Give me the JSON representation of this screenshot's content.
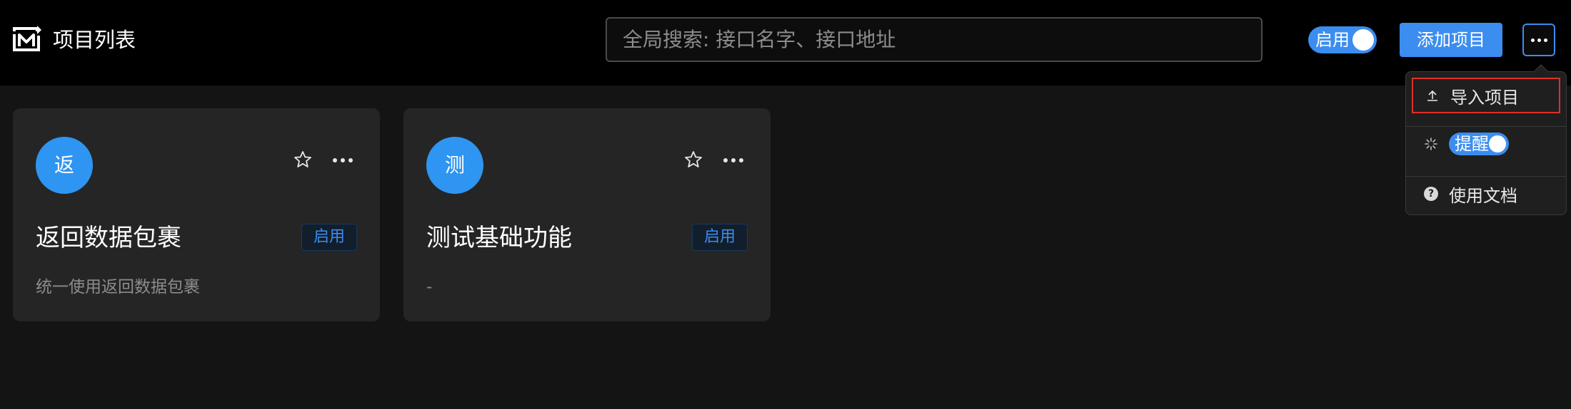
{
  "header": {
    "title": "项目列表",
    "logo_icon": "m-logo-icon",
    "search_placeholder": "全局搜索: 接口名字、接口地址",
    "toggle_label": "启用",
    "add_button_label": "添加项目",
    "more_icon": "ellipsis-icon"
  },
  "dropdown": {
    "items": [
      {
        "label": "导入项目",
        "icon": "upload-icon"
      },
      {
        "label": "提醒",
        "icon": "loading-spinner-icon",
        "type": "switch",
        "on": true
      },
      {
        "label": "使用文档",
        "icon": "question-circle-icon"
      }
    ]
  },
  "projects": [
    {
      "avatar": "返",
      "title": "返回数据包裹",
      "status": "启用",
      "description": "统一使用返回数据包裹"
    },
    {
      "avatar": "测",
      "title": "测试基础功能",
      "status": "启用",
      "description": "-"
    }
  ],
  "colors": {
    "accent": "#3b8df0",
    "avatar_bg": "#2f95f2",
    "highlight_border": "#e0302b",
    "header_bg": "#000000",
    "page_bg": "#141414",
    "card_bg": "#252525"
  }
}
